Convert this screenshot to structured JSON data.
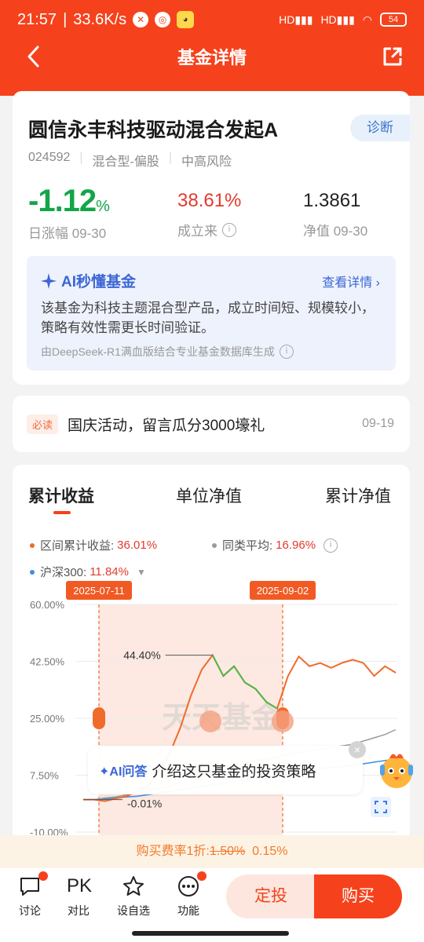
{
  "status": {
    "time": "21:57",
    "speed": "33.6K/s",
    "battery": "54"
  },
  "nav": {
    "title": "基金详情"
  },
  "fund": {
    "name": "圆信永丰科技驱动混合发起A",
    "diagnose_label": "诊断",
    "code": "024592",
    "type": "混合型-偏股",
    "risk": "中高风险",
    "daily_change": "-1.12",
    "daily_change_unit": "%",
    "daily_change_label": "日涨幅 09-30",
    "since_inception": "38.61%",
    "since_inception_label": "成立来",
    "nav_value": "1.3861",
    "nav_label": "净值 09-30"
  },
  "ai": {
    "title": "AI秒懂基金",
    "more": "查看详情",
    "text": "该基金为科技主题混合型产品，成立时间短、规模较小，策略有效性需更长时间验证。",
    "footer": "由DeepSeek-R1满血版结合专业基金数据库生成"
  },
  "notice": {
    "tag": "必读",
    "text": "国庆活动，留言瓜分3000壕礼",
    "date": "09-19"
  },
  "tabs": [
    "累计收益",
    "单位净值",
    "累计净值"
  ],
  "legend": {
    "range_label": "区间累计收益:",
    "range_value": "36.01%",
    "peer_label": "同类平均:",
    "peer_value": "16.96%",
    "hs300_label": "沪深300:",
    "hs300_value": "11.84%"
  },
  "colors": {
    "brand": "#f5421c",
    "fund_line": "#f06a2a",
    "drop_line": "#4cb84a",
    "peer_line": "#9a9a9a",
    "hs300_line": "#3d8fe0"
  },
  "chart_data": {
    "type": "line",
    "ylim": [
      -10,
      60
    ],
    "y_ticks": [
      "60.00%",
      "42.50%",
      "25.00%",
      "7.50%",
      "-10.00%"
    ],
    "selection_start": "2025-07-11",
    "selection_end": "2025-09-02",
    "peak_label": "44.40%",
    "start_label": "-0.01%",
    "watermark": "天天基金",
    "series": [
      {
        "values": [
          0,
          0,
          -0.5,
          0.3,
          1,
          2.5,
          4,
          9,
          14,
          22,
          32,
          40,
          44.4,
          38,
          41,
          36,
          34,
          30,
          28,
          38,
          44,
          41,
          42,
          40.5,
          42,
          43,
          42,
          38,
          41,
          39
        ]
      },
      {
        "values": [
          0,
          0,
          0.5,
          0.8,
          1.5,
          2,
          3,
          3.5,
          4,
          5.5,
          7,
          8,
          9.5,
          10,
          11,
          11,
          12,
          12.5,
          13,
          14,
          14.5,
          15,
          15.5,
          16,
          16.5,
          17,
          18,
          19,
          20,
          21.5
        ]
      },
      {
        "values": [
          0,
          0,
          0.2,
          0.5,
          0.8,
          1,
          1.5,
          2,
          2.5,
          3,
          3.5,
          4,
          4.5,
          5,
          5.5,
          6,
          6.5,
          7,
          7.5,
          8,
          8.5,
          9,
          9.5,
          10,
          10,
          10.5,
          11,
          11.5,
          12,
          12.5
        ]
      }
    ]
  },
  "ask": {
    "ai_tag": "AI问答",
    "text": "介绍这只基金的投资策略"
  },
  "fee": {
    "label": "购买费率1折:",
    "original": "1.50%",
    "discount": "0.15%"
  },
  "bottom": {
    "discuss": "讨论",
    "pk_icon": "PK",
    "compare": "对比",
    "watch": "设自选",
    "func": "功能",
    "fixed": "定投",
    "buy": "购买"
  }
}
